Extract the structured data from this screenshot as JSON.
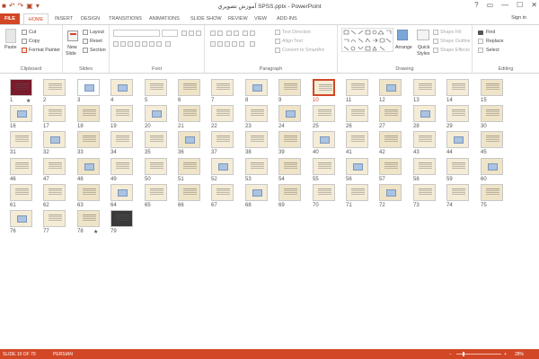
{
  "window": {
    "title": "آموزش تصويري SPSS.pptx - PowerPoint",
    "controls": [
      "?",
      "▭",
      "—",
      "☐",
      "✕"
    ]
  },
  "qat": [
    {
      "name": "save-icon",
      "glyph": "💾"
    },
    {
      "name": "undo-icon",
      "glyph": "↶"
    },
    {
      "name": "redo-icon",
      "glyph": "↷"
    },
    {
      "name": "slideshow-icon",
      "glyph": "▣"
    },
    {
      "name": "customize-icon",
      "glyph": "▾"
    }
  ],
  "tabs": {
    "file": "FILE",
    "items": [
      "HOME",
      "INSERT",
      "DESIGN",
      "TRANSITIONS",
      "ANIMATIONS",
      "SLIDE SHOW",
      "REVIEW",
      "VIEW",
      "ADD-INS"
    ],
    "active": "HOME",
    "signin": "Sign in"
  },
  "ribbon": {
    "clipboard": {
      "label": "Clipboard",
      "paste": "Paste",
      "cut": "Cut",
      "copy": "Copy",
      "format_painter": "Format Painter"
    },
    "slides": {
      "label": "Slides",
      "new_slide": "New",
      "new_slide2": "Slide",
      "layout": "Layout",
      "reset": "Reset",
      "section": "Section"
    },
    "font": {
      "label": "Font"
    },
    "paragraph": {
      "label": "Paragraph",
      "text_direction": "Text Direction",
      "align_text": "Align Text",
      "convert_smartart": "Convert to SmartArt"
    },
    "drawing": {
      "label": "Drawing",
      "arrange": "Arrange",
      "quick_styles": "Quick",
      "quick_styles2": "Styles",
      "shape_fill": "Shape Fill",
      "shape_outline": "Shape Outline",
      "shape_effects": "Shape Effects"
    },
    "editing": {
      "label": "Editing",
      "find": "Find",
      "replace": "Replace",
      "select": "Select"
    }
  },
  "slides": {
    "count": 79,
    "selected": 10,
    "starred": [
      1,
      78
    ]
  },
  "status": {
    "slide_of": "SLIDE 10 OF 79",
    "language": "PERSIAN",
    "zoom": "28%",
    "zoom_minus": "−",
    "zoom_plus": "+"
  },
  "colors": {
    "accent": "#d24726",
    "slide_bg": "#f4ecd6",
    "slide_bg_alt": "#efe4c7",
    "slide_border_selected": "#d24726"
  }
}
